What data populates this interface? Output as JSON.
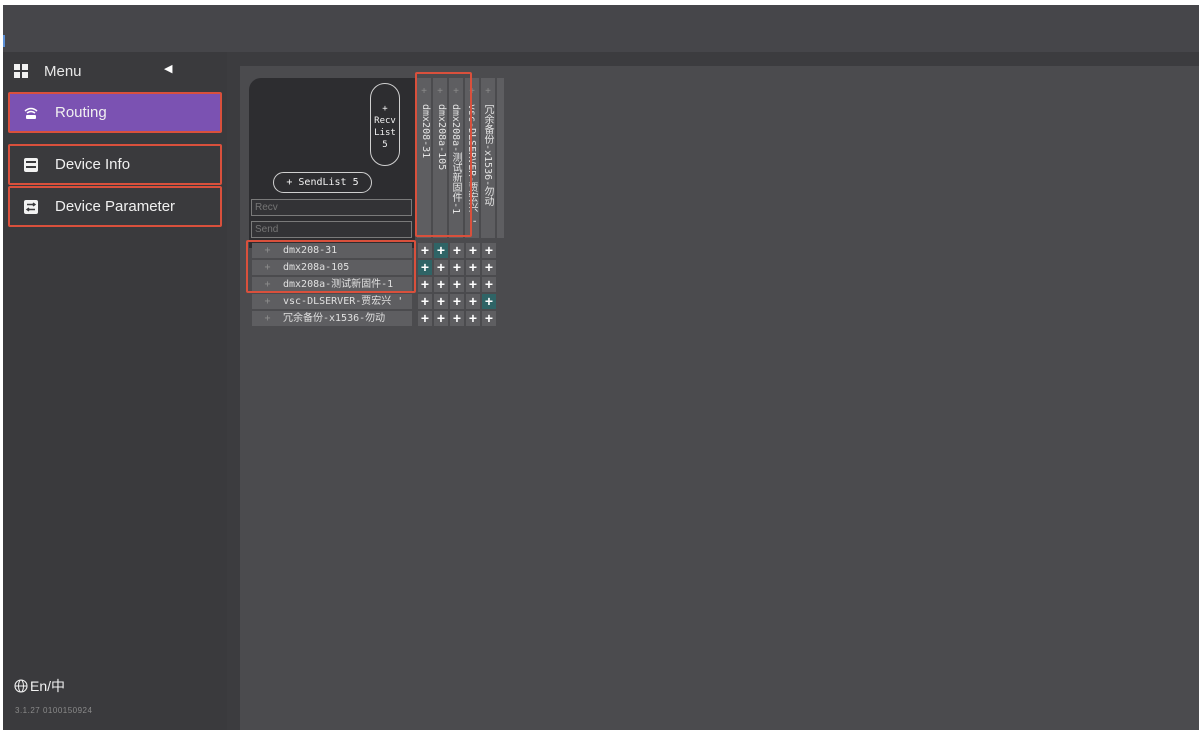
{
  "sidebar": {
    "menu_label": "Menu",
    "items": [
      {
        "label": "Routing",
        "icon": "wifi-router-icon",
        "active": true
      },
      {
        "label": "Device Info",
        "icon": "device-info-icon",
        "active": false
      },
      {
        "label": "Device Parameter",
        "icon": "device-parameter-icon",
        "active": false
      }
    ],
    "language": "En/中",
    "version": "3.1.27  0100150924"
  },
  "matrix": {
    "recv_list": {
      "prefix": "+",
      "line1": "Recv",
      "line2": "List",
      "count": "5"
    },
    "send_list_label": "+ SendList 5",
    "recv_placeholder": "Recv",
    "send_placeholder": "Send",
    "row_prefix": "+",
    "col_prefix": "+",
    "send_rows": [
      "dmx208-31",
      "dmx208a-105",
      "dmx208a-测试新固件-1",
      "vsc-DLSERVER-贾宏兴 '",
      "冗余备份-x1536-勿动"
    ],
    "recv_cols": [
      "dmx208-31",
      "dmx208a-105",
      "dmx208a-测试新固件-1",
      "vsc-DLSERVER-贾宏兴 '",
      "冗余备份-x1536-勿动"
    ],
    "cell_symbol": "+",
    "active_cells": [
      [
        0,
        1
      ],
      [
        1,
        0
      ],
      [
        3,
        4
      ]
    ]
  },
  "colors": {
    "active_nav": "#7b52b2",
    "highlight": "#d9503c",
    "active_cell": "#2f6466"
  }
}
